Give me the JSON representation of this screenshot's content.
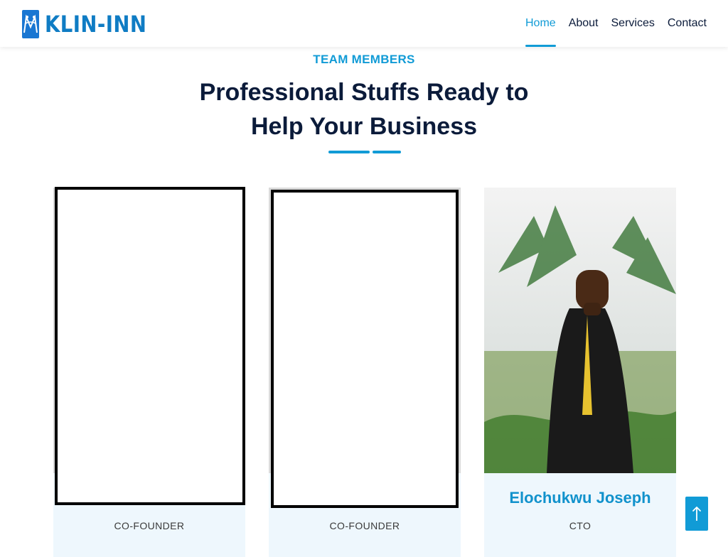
{
  "header": {
    "brand": "KLIN-INN",
    "nav": [
      {
        "label": "Home",
        "active": true
      },
      {
        "label": "About",
        "active": false
      },
      {
        "label": "Services",
        "active": false
      },
      {
        "label": "Contact",
        "active": false
      }
    ]
  },
  "section": {
    "kicker": "TEAM MEMBERS",
    "title": "Professional Stuffs Ready to Help Your Business"
  },
  "team": [
    {
      "name": "",
      "role": "CO-FOUNDER",
      "photo": "redacted"
    },
    {
      "name": "",
      "role": "CO-FOUNDER",
      "photo": "redacted"
    },
    {
      "name": "Elochukwu Joseph",
      "role": "CTO",
      "photo": "portrait-outdoors"
    }
  ],
  "colors": {
    "accent": "#119bd6",
    "brand": "#0f7cc4",
    "dark": "#0b1b3a",
    "cardFooter": "#eef7fd"
  },
  "icons": {
    "logo": "klin-inn-logo-icon",
    "scrollTop": "arrow-up-icon"
  }
}
